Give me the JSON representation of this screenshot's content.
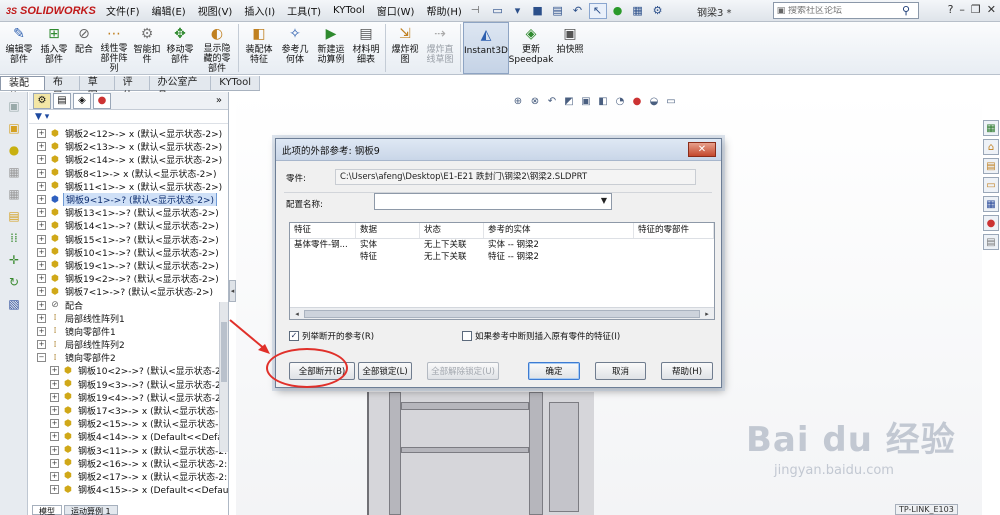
{
  "app": {
    "logo_ds": "3S",
    "logo_text": "SOLIDWORKS",
    "doc_title": "钢梁3 *"
  },
  "menu": [
    "文件(F)",
    "编辑(E)",
    "视图(V)",
    "插入(I)",
    "工具(T)",
    "KYTool",
    "窗口(W)",
    "帮助(H)"
  ],
  "search": {
    "placeholder": "搜索社区论坛"
  },
  "ribbon": [
    {
      "label": "编辑零\n部件",
      "icon": "edit-component-icon"
    },
    {
      "label": "插入零\n部件",
      "icon": "insert-component-icon"
    },
    {
      "label": "配合",
      "icon": "mate-icon"
    },
    {
      "label": "线性零\n部件阵\n列",
      "icon": "linear-pattern-icon"
    },
    {
      "label": "智能扣\n件",
      "icon": "smart-fastener-icon"
    },
    {
      "label": "移动零\n部件",
      "icon": "move-component-icon"
    },
    {
      "label": "显示隐\n藏的零\n部件",
      "icon": "show-hidden-icon"
    },
    {
      "label": "装配体\n特征",
      "icon": "assembly-feature-icon"
    },
    {
      "label": "参考几\n何体",
      "icon": "reference-geometry-icon"
    },
    {
      "label": "新建运\n动算例",
      "icon": "new-motion-study-icon"
    },
    {
      "label": "材料明\n细表",
      "icon": "bom-icon"
    },
    {
      "label": "爆炸视\n图",
      "icon": "exploded-view-icon"
    },
    {
      "label": "爆炸直\n线草图",
      "icon": "explode-line-sketch-icon"
    },
    {
      "label": "Instant3D",
      "icon": "instant3d-icon"
    },
    {
      "label": "更新\nSpeedpak",
      "icon": "speedpak-icon"
    },
    {
      "label": "拍快照",
      "icon": "snapshot-icon"
    }
  ],
  "tabs": [
    "装配体",
    "布局",
    "草图",
    "评估",
    "办公室产品",
    "KYTool"
  ],
  "tree": [
    {
      "label": "钢板2<12>-> x (默认<显示状态-2>)",
      "indent": 0
    },
    {
      "label": "钢板2<13>-> x (默认<显示状态-2>)",
      "indent": 0
    },
    {
      "label": "钢板2<14>-> x (默认<显示状态-2>)",
      "indent": 0
    },
    {
      "label": "钢板8<1>-> x (默认<显示状态-2>)",
      "indent": 0
    },
    {
      "label": "钢板11<1>-> x (默认<显示状态-2>)",
      "indent": 0
    },
    {
      "label": "钢板9<1>->? (默认<显示状态-2>)",
      "indent": 0,
      "selected": true
    },
    {
      "label": "钢板13<1>->? (默认<显示状态-2>)",
      "indent": 0
    },
    {
      "label": "钢板14<1>->? (默认<显示状态-2>)",
      "indent": 0
    },
    {
      "label": "钢板15<1>->? (默认<显示状态-2>)",
      "indent": 0
    },
    {
      "label": "钢板10<1>->? (默认<显示状态-2>)",
      "indent": 0
    },
    {
      "label": "钢板19<1>->? (默认<显示状态-2>)",
      "indent": 0
    },
    {
      "label": "钢板19<2>->? (默认<显示状态-2>)",
      "indent": 0
    },
    {
      "label": "钢板7<1>->? (默认<显示状态-2>)",
      "indent": 0
    },
    {
      "label": "配合",
      "indent": 0,
      "type": "mate"
    },
    {
      "label": "局部线性阵列1",
      "indent": 0,
      "type": "pattern"
    },
    {
      "label": "镜向零部件1",
      "indent": 0,
      "type": "pattern"
    },
    {
      "label": "局部线性阵列2",
      "indent": 0,
      "type": "pattern"
    },
    {
      "label": "镜向零部件2",
      "indent": 0,
      "type": "pattern",
      "open": true
    },
    {
      "label": "钢板10<2>->? (默认<显示状态-2>",
      "indent": 1
    },
    {
      "label": "钢板19<3>->? (默认<显示状态-2>",
      "indent": 1
    },
    {
      "label": "钢板19<4>->? (默认<显示状态-2>",
      "indent": 1
    },
    {
      "label": "钢板17<3>-> x (默认<显示状态-2:",
      "indent": 1
    },
    {
      "label": "钢板2<15>-> x (默认<显示状态-2:",
      "indent": 1
    },
    {
      "label": "钢板4<14>-> x (Default<<Defaul",
      "indent": 1
    },
    {
      "label": "钢板3<11>-> x (默认<显示状态-2:",
      "indent": 1
    },
    {
      "label": "钢板2<16>-> x (默认<显示状态-2:",
      "indent": 1
    },
    {
      "label": "钢板2<17>-> x (默认<显示状态-2:",
      "indent": 1
    },
    {
      "label": "钢板4<15>-> x (Default<<Defaul",
      "indent": 1
    }
  ],
  "bottom_tabs": [
    "模型",
    "运动算例 1"
  ],
  "watermark": {
    "main": "Bai du 经验",
    "sub": "jingyan.baidu.com"
  },
  "status_label": "TP-LINK_E103",
  "dialog": {
    "title": "此项的外部参考: 钢板9",
    "close": "✕",
    "part_label": "零件:",
    "part_path": "C:\\Users\\afeng\\Desktop\\E1-E21 跌封门\\钢梁2\\钢梁2.SLDPRT",
    "config_label": "配置名称:",
    "config_value": "",
    "columns": [
      "特征",
      "数据",
      "状态",
      "参考的实体",
      "特征的零部件"
    ],
    "rows": [
      [
        "基体零件-钢...",
        "实体",
        "无上下关联",
        "实体 -- 钢梁2",
        ""
      ],
      [
        "",
        "特征",
        "无上下关联",
        "特征 -- 钢梁2",
        ""
      ]
    ],
    "list_broken_label": "列举断开的参考(R)",
    "list_broken_checked": true,
    "insert_missing_label": "如果参考中断则插入原有零件的特征(I)",
    "insert_missing_checked": false,
    "buttons": {
      "break_all": "全部断开(B)",
      "lock_all": "全部锁定(L)",
      "unlock_all": "全部解除锁定(U)",
      "ok": "确定",
      "cancel": "取消",
      "help": "帮助(H)"
    }
  }
}
